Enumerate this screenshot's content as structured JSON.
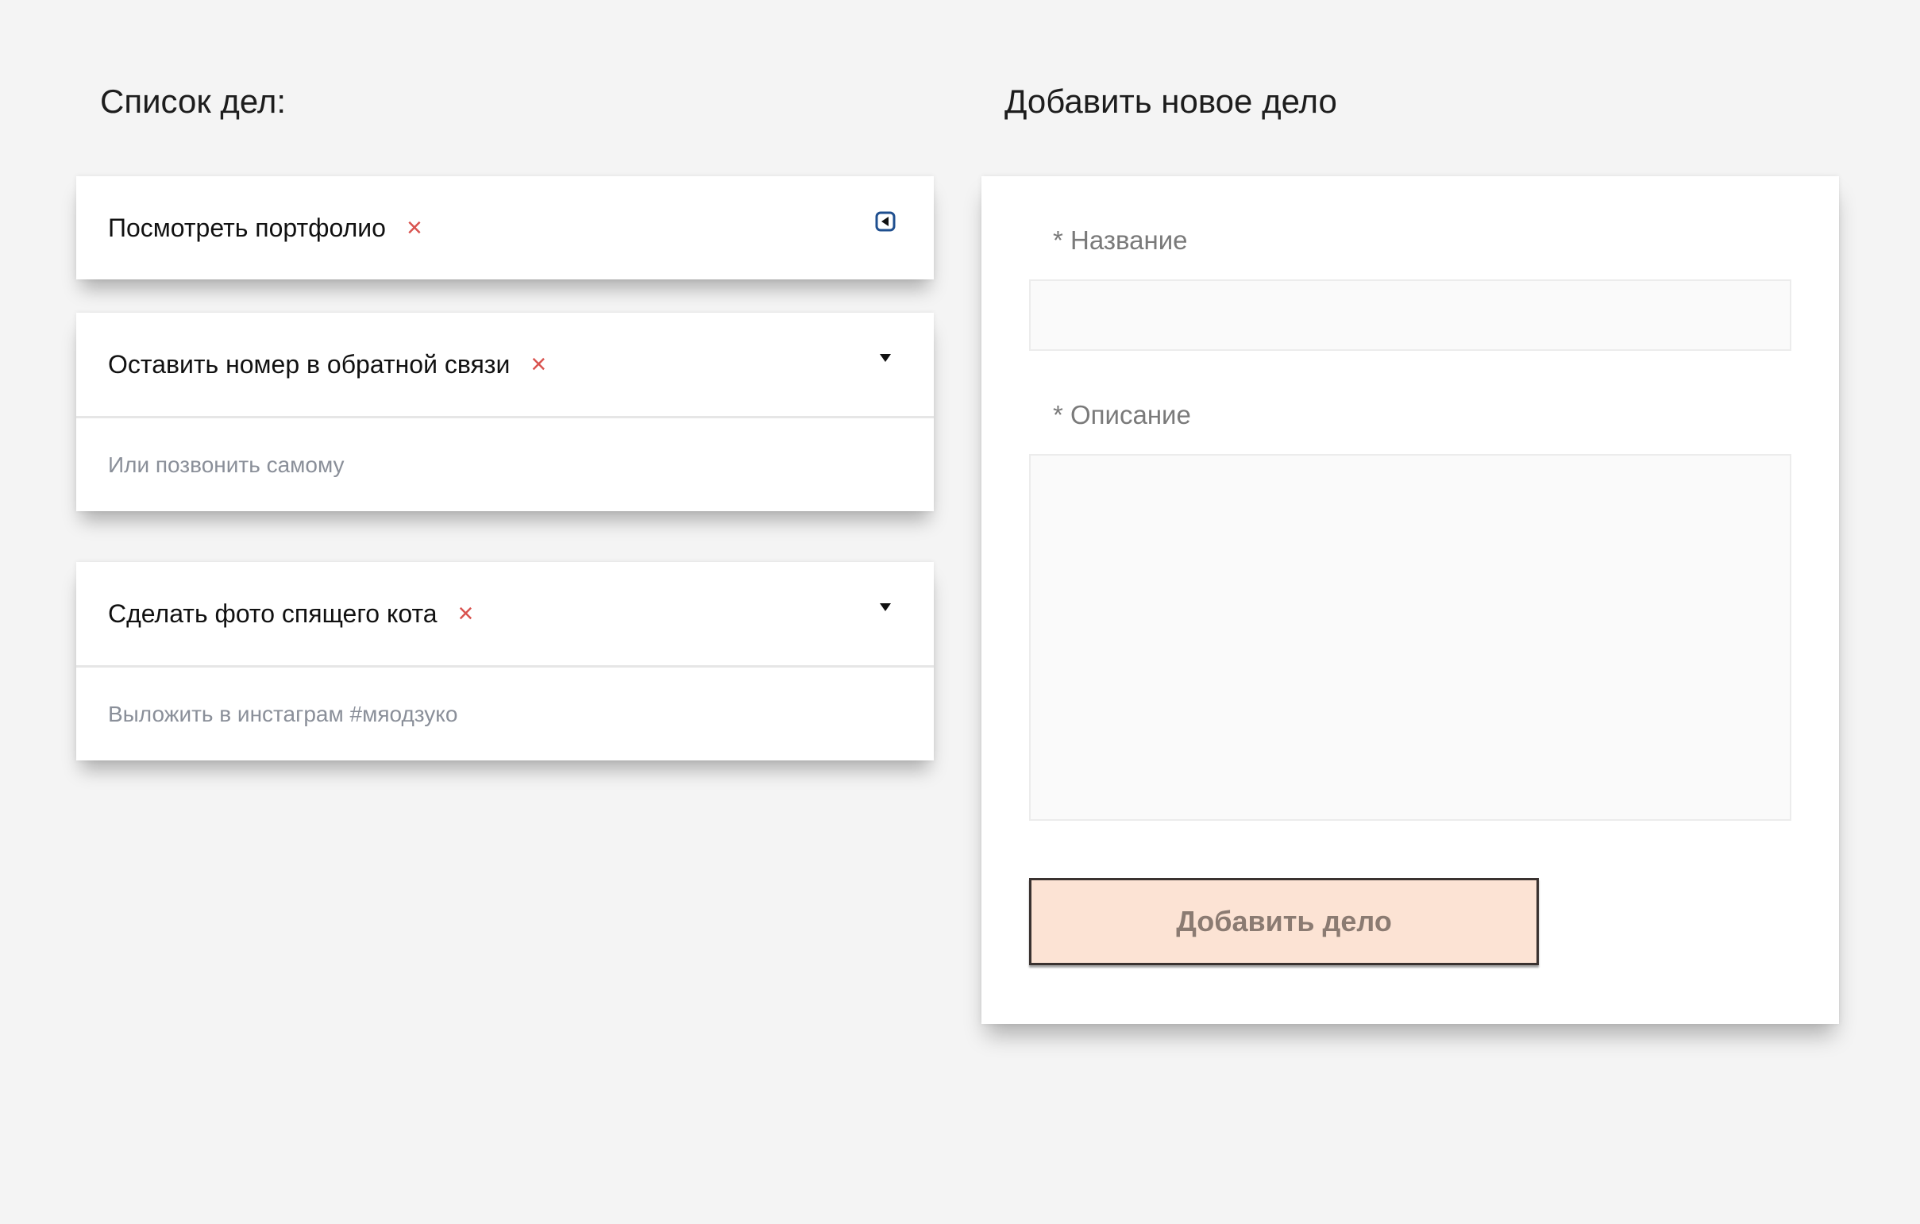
{
  "list": {
    "heading": "Список дел:",
    "items": [
      {
        "title": "Посмотреть портфолио",
        "remove_icon": "×",
        "toggle_icon": "collapse-left-icon",
        "expanded": false
      },
      {
        "title": "Оставить номер в обратной связи",
        "remove_icon": "×",
        "toggle_icon": "▼",
        "expanded": true,
        "description": "Или позвонить самому"
      },
      {
        "title": "Сделать фото спящего кота",
        "remove_icon": "×",
        "toggle_icon": "▼",
        "expanded": true,
        "description": "Выложить в инстаграм #мяодзуко"
      }
    ]
  },
  "form": {
    "heading": "Добавить новое дело",
    "name_label": "* Название",
    "name_value": "",
    "description_label": "* Описание",
    "description_value": "",
    "submit_label": "Добавить дело"
  },
  "colors": {
    "background": "#f4f4f4",
    "card": "#ffffff",
    "remove": "#d9534f",
    "description_text": "#8a8f99",
    "button_bg": "#fce3d4",
    "button_text": "#8b7b72",
    "toggle_accent": "#1f4f8f"
  }
}
